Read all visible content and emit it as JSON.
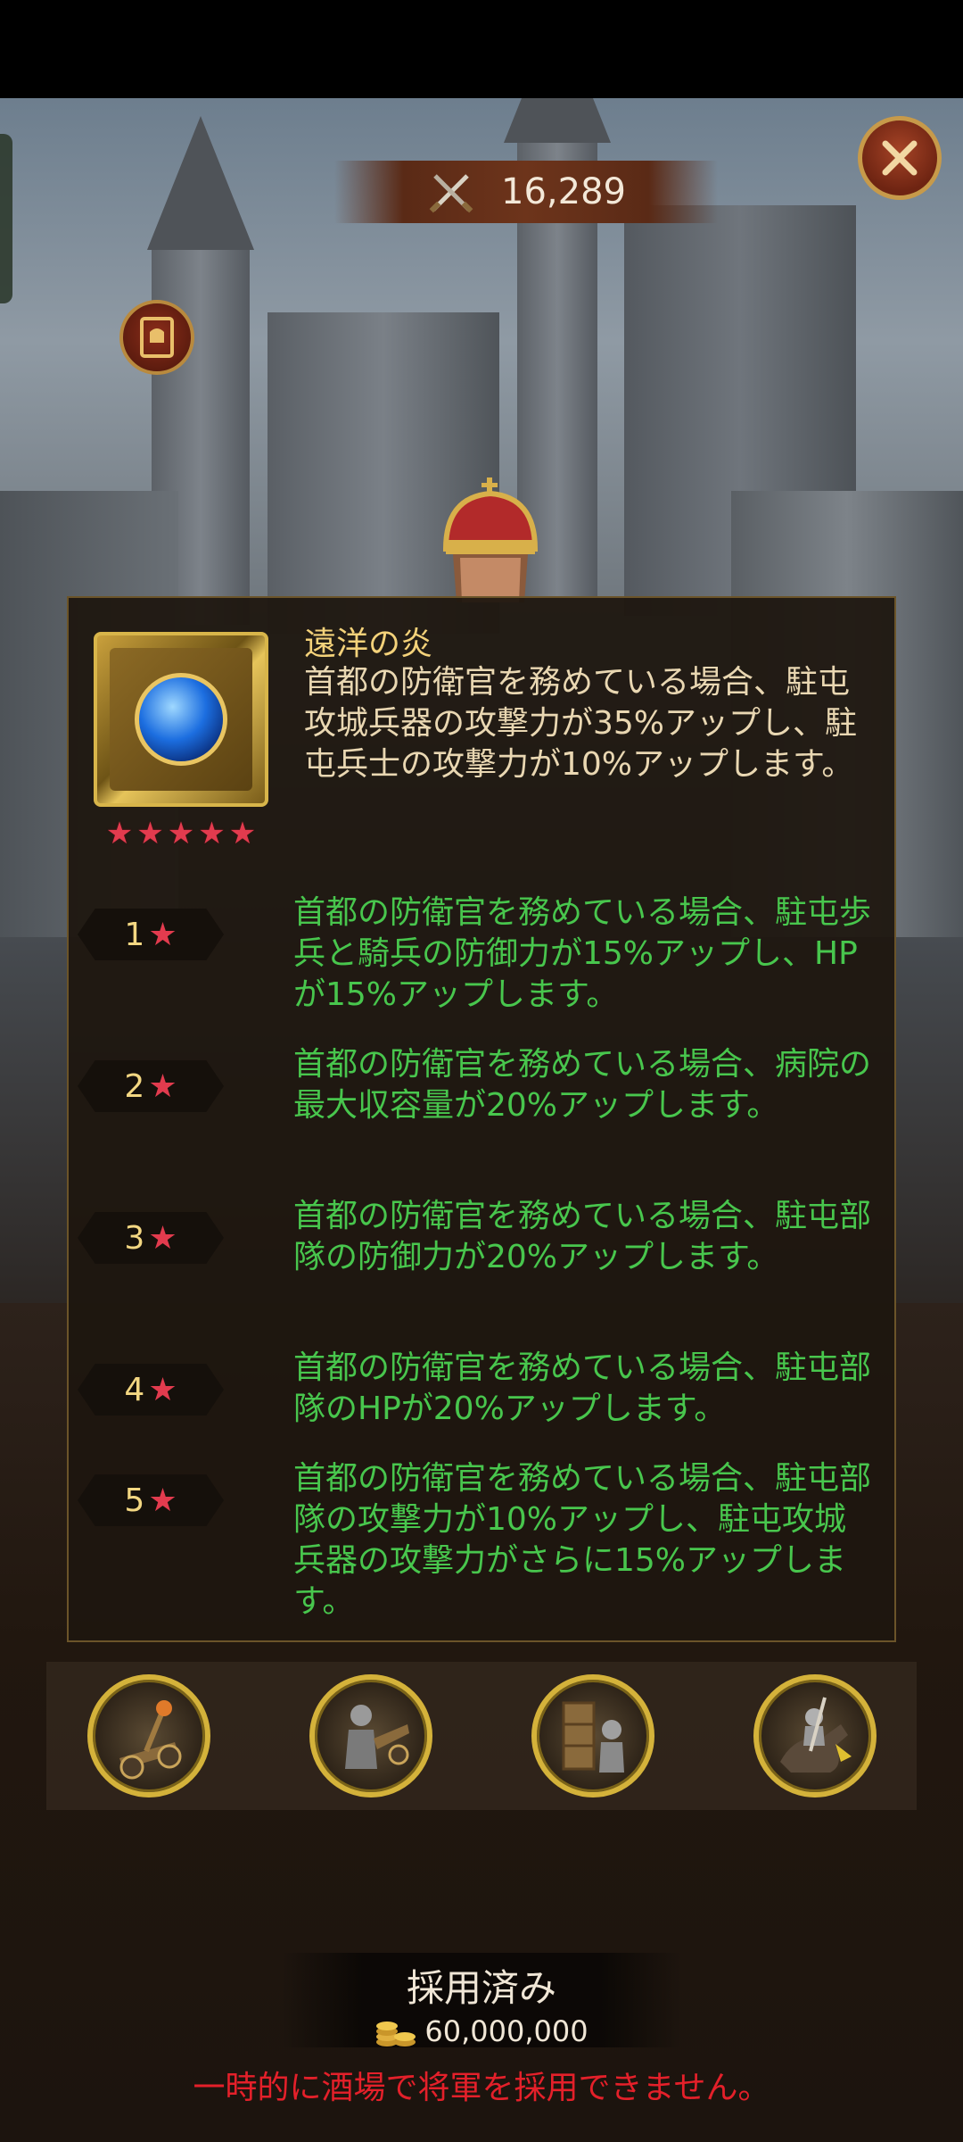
{
  "power": {
    "value": "16,289"
  },
  "skill": {
    "name": "遠洋の炎",
    "description": "首都の防衛官を務めている場合、駐屯攻城兵器の攻撃力が35%アップし、駐屯兵士の攻撃力が10%アップします。",
    "stars": 5
  },
  "levels": [
    {
      "num": "1",
      "desc": "首都の防衛官を務めている場合、駐屯歩兵と騎兵の防御力が15%アップし、HPが15%アップします。"
    },
    {
      "num": "2",
      "desc": "首都の防衛官を務めている場合、病院の最大収容量が20%アップします。"
    },
    {
      "num": "3",
      "desc": "首都の防衛官を務めている場合、駐屯部隊の防御力が20%アップします。"
    },
    {
      "num": "4",
      "desc": "首都の防衛官を務めている場合、駐屯部隊のHPが20%アップします。"
    },
    {
      "num": "5",
      "desc": "首都の防衛官を務めている場合、駐屯部隊の攻撃力が10%アップし、駐屯攻城兵器の攻撃力がさらに15%アップします。"
    }
  ],
  "troops": [
    "siege-catapult-icon",
    "siege-crew-icon",
    "siege-tower-icon",
    "cavalry-knight-icon"
  ],
  "hire": {
    "status": "採用済み",
    "cost": "60,000,000",
    "warning": "一時的に酒場で将軍を採用できません。"
  },
  "colors": {
    "level_text": "#48c64d",
    "title": "#f4d27a",
    "warning": "#e4202a",
    "star": "#e23b4e"
  }
}
